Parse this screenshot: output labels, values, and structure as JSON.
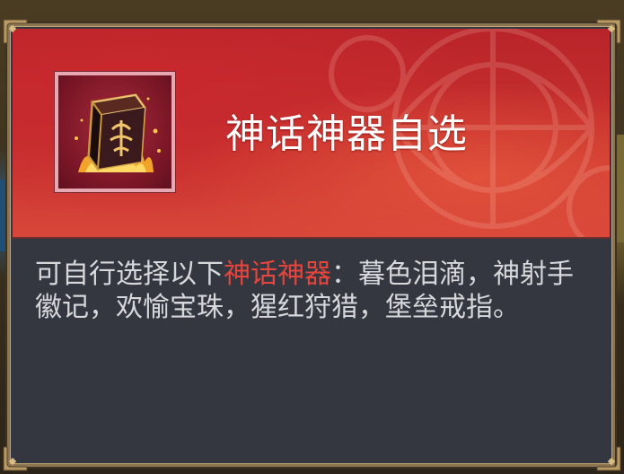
{
  "tooltip": {
    "title": "神话神器自选",
    "item_icon": "mythic-artifact-icon",
    "description": {
      "prefix": "可自行选择以下",
      "highlight": "神话神器",
      "suffix": "：暮色泪滴，神射手徽记，欢愉宝珠，猩红狩猎，堡垒戒指。"
    }
  },
  "colors": {
    "header_red": "#c8322e",
    "body_bg": "#34373f",
    "highlight": "#e6453d",
    "frame_gold": "#8b7550",
    "icon_border": "#e8a8b2"
  }
}
